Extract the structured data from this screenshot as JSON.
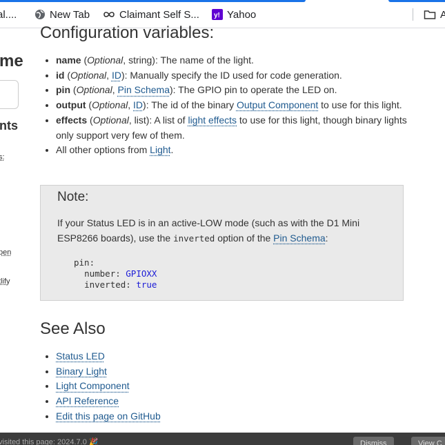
{
  "bookmarks": {
    "items": [
      {
        "label": "al....",
        "icon": "page-icon"
      },
      {
        "label": "New Tab",
        "icon": "globe-icon"
      },
      {
        "label": "Claimant Self S...",
        "icon": "infinity-icon"
      },
      {
        "label": "Yahoo",
        "icon": "yahoo-icon"
      }
    ],
    "folder_label": "A"
  },
  "sidebar": {
    "title_fragment": "me",
    "section_fragment": "nts",
    "links": [
      "s:",
      "pen",
      "tlify"
    ]
  },
  "config": {
    "heading": "Configuration variables:",
    "items": [
      {
        "name": "name",
        "optional": "Optional",
        "type_sep": ", string): The name of the light."
      },
      {
        "name": "id",
        "optional": "Optional",
        "type_link": "ID",
        "desc": "): Manually specify the ID used for code generation."
      },
      {
        "name": "pin",
        "optional": "Optional",
        "type_link": "Pin Schema",
        "desc": "): The GPIO pin to operate the LED on."
      },
      {
        "name": "output",
        "optional": "Optional",
        "type_link": "ID",
        "desc_a": "): The id of the binary ",
        "desc_link": "Output Component",
        "desc_b": " to use for this light."
      },
      {
        "name": "effects",
        "optional": "Optional",
        "type_text": ", list): A list of ",
        "desc_link": "light effects",
        "desc_b": " to use for this light, though binary lights only support very few of them."
      },
      {
        "pre": "All other options from ",
        "link": "Light",
        "post": "."
      }
    ]
  },
  "note": {
    "title": "Note:",
    "text_a": "If your Status LED is in an active-LOW mode (such as with the D1 Mini ESP8266 boards), use the ",
    "code": "inverted",
    "text_b": " option of the ",
    "link": "Pin Schema",
    "text_c": ":",
    "yaml": {
      "l1": "pin:",
      "l2_key": "number: ",
      "l2_val": "GPIOXX",
      "l3_key": "inverted: ",
      "l3_val": "true"
    }
  },
  "see_also": {
    "heading": "See Also",
    "links": [
      "Status LED",
      "Binary Light",
      "Light Component",
      "API Reference",
      "Edit this page on GitHub"
    ]
  },
  "bottom_bar": {
    "message": "visited this page: 2024.7.0",
    "dismiss": "Dismiss",
    "view": "View C"
  },
  "colors": {
    "link": "#1f5a8f",
    "note_bg": "#eaeaea",
    "yahoo": "#6001d2",
    "tab_blue": "#1a73e8"
  }
}
